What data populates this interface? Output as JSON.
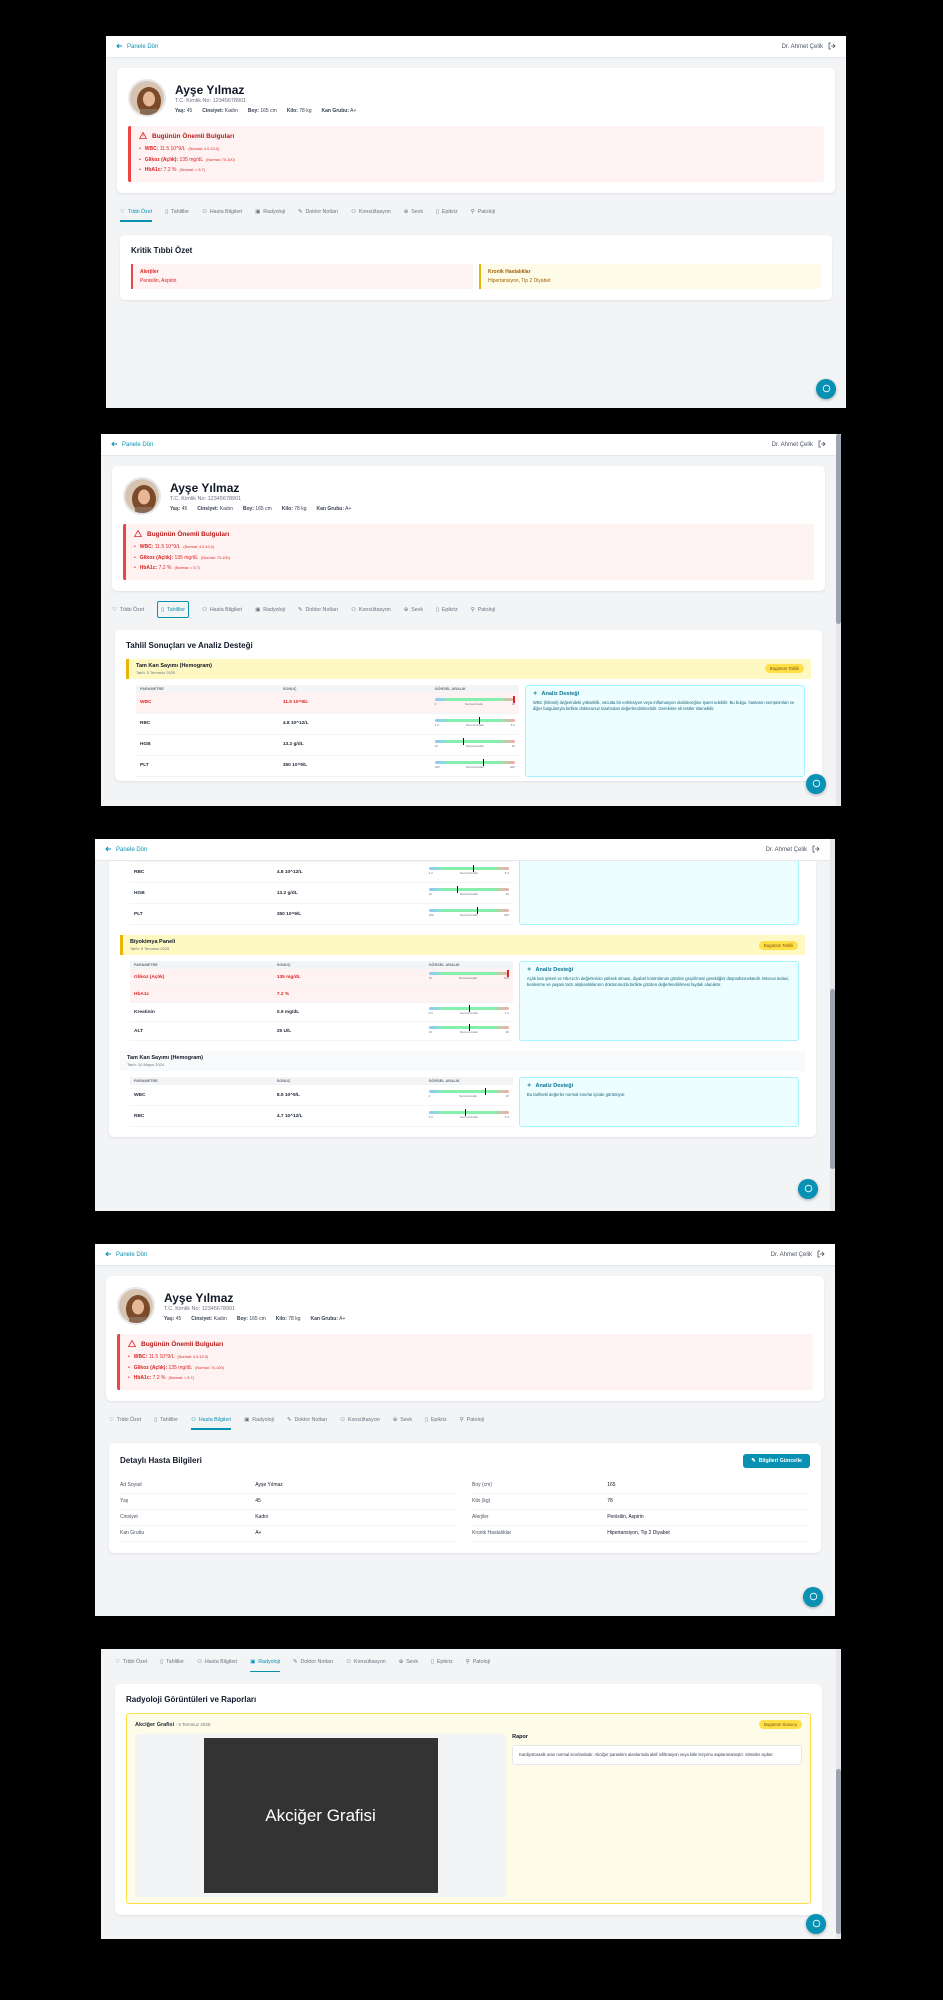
{
  "nav": {
    "back_label": "Panele Dön",
    "doctor": "Dr. Ahmet Çelik"
  },
  "patient": {
    "name": "Ayşe Yılmaz",
    "tc": "T.C. Kimlik No: 12345678901",
    "stats": [
      {
        "k": "Yaş:",
        "v": "45"
      },
      {
        "k": "Cinsiyet:",
        "v": "Kadın"
      },
      {
        "k": "Boy:",
        "v": "165 cm"
      },
      {
        "k": "Kilo:",
        "v": "78 kg"
      },
      {
        "k": "Kan Grubu:",
        "v": "A+"
      }
    ]
  },
  "alert": {
    "title": "Bugünün Önemli Bulguları",
    "items": [
      {
        "label": "WBC:",
        "value": "11.5 10^9/L",
        "norm": "(Normal: 4.0-10.0)"
      },
      {
        "label": "Glikoz (Açlık):",
        "value": "135 mg/dL",
        "norm": "(Normal: 70-100)"
      },
      {
        "label": "HbA1c:",
        "value": "7.2 %",
        "norm": "(Normal: < 5.7)"
      }
    ]
  },
  "tabs": [
    "Tıbbi Özet",
    "Tahliller",
    "Hasta Bilgileri",
    "Radyoloji",
    "Doktor Notları",
    "Konsültasyon",
    "Sevk",
    "Epikriz",
    "Patoloji"
  ],
  "summary": {
    "title": "Kritik Tıbbi Özet",
    "allergies_title": "Alerjiler",
    "allergies": "Penisilin, Aspirin",
    "chronic_title": "Kronik Hastalıklar",
    "chronic": "Hipertansiyon, Tip 2 Diyabet"
  },
  "labs": {
    "title": "Tahlil Sonuçları ve Analiz Desteği",
    "col_param": "PARAMETRE",
    "col_result": "SONUÇ",
    "col_range": "GÖRSEL ARALIK",
    "range_label": "Normal Aralık",
    "analysis_title": "Analiz Desteği",
    "today_badge": "Bugünün Tahlili",
    "hemogram": {
      "name": "Tam Kan Sayımı (Hemogram)",
      "date": "Tarih: 5 Temmuz 2025",
      "rows": [
        {
          "p": "WBC",
          "r": "11.5 10^9/L",
          "min": "4",
          "max": "10",
          "level": 0.98,
          "high": true
        },
        {
          "p": "RBC",
          "r": "4.8 10^12/L",
          "min": "4.2",
          "max": "5.4",
          "level": 0.55,
          "high": false
        },
        {
          "p": "HGB",
          "r": "13.2 g/dL",
          "min": "12",
          "max": "16",
          "level": 0.35,
          "high": false
        },
        {
          "p": "PLT",
          "r": "350 10^9/L",
          "min": "150",
          "max": "400",
          "level": 0.6,
          "high": false
        }
      ],
      "analysis": "WBC (lökosit) değerindeki yükseklik, vücutta bir enfeksiyon veya inflamasyon olabileceğine işaret edebilir. Bu bulgu, hastanın semptomları ve diğer bulgularıyla birlikte doktorunuz tarafından değerlendirilmelidir. Gerekirse ek testler istenebilir."
    },
    "biochem": {
      "name": "Biyokimya Paneli",
      "date": "Tarih: 5 Temmuz 2025",
      "rows": [
        {
          "p": "Glikoz (Açlık)",
          "r": "135 mg/dL",
          "min": "70",
          "max": "100",
          "level": 0.98,
          "high": true,
          "bar": true
        },
        {
          "p": "HbA1c",
          "r": "7.2 %",
          "high": true,
          "bar": false
        },
        {
          "p": "Kreatinin",
          "r": "0.9 mg/dL",
          "min": "0.6",
          "max": "1.2",
          "level": 0.5,
          "high": false,
          "bar": true
        },
        {
          "p": "ALT",
          "r": "25 U/L",
          "min": "10",
          "max": "40",
          "level": 0.5,
          "high": false,
          "bar": true
        }
      ],
      "analysis": "Açlık kan şekeri ve HbA1c'in değerlerinin yüksek olması, diyabet kontrolünün gözden geçirilmesi gerektiğini düşündürmektedir. Mevcut tedavi, beslenme ve yaşam tarzı alışkanlıklarının doktorunuzla birlikte gözden değerlendirilmesi faydalı olacaktır."
    },
    "old": {
      "name": "Tam Kan Sayımı (Hemogram)",
      "date": "Tarih: 10 Mayıs 2024",
      "rows": [
        {
          "p": "WBC",
          "r": "8.5 10^9/L",
          "min": "4",
          "max": "10",
          "level": 0.7,
          "high": false
        },
        {
          "p": "RBC",
          "r": "4.7 10^12/L",
          "min": "4.2",
          "max": "5.4",
          "level": 0.45,
          "high": false
        }
      ],
      "analysis": "Bu tarihteki değerler normal sınırlar içinde görünüyor."
    }
  },
  "details": {
    "title": "Detaylı Hasta Bilgileri",
    "update_button": "Bilgileri Güncelle",
    "left": [
      {
        "k": "Ad Soyad",
        "v": "Ayşe Yılmaz"
      },
      {
        "k": "Yaş",
        "v": "45"
      },
      {
        "k": "Cinsiyet",
        "v": "Kadın"
      },
      {
        "k": "Kan Grubu",
        "v": "A+"
      }
    ],
    "right": [
      {
        "k": "Boy (cm)",
        "v": "165"
      },
      {
        "k": "Kilo (kg)",
        "v": "78"
      },
      {
        "k": "Alerjiler",
        "v": "Penisilin, Aspirin"
      },
      {
        "k": "Kronik Hastalıklar",
        "v": "Hipertansiyon, Tip 2 Diyabet"
      }
    ]
  },
  "radiology": {
    "title": "Radyoloji Görüntüleri ve Raporları",
    "item_name": "Akciğer Grafisi",
    "item_date": "- 5 Temmuz 2025",
    "badge": "Bugünün Sonucu",
    "image_label": "Akciğer Grafisi",
    "report_title": "Rapor",
    "report_text": "Kardiyotorasik oran normal sınırlardadır. Akciğer parankim alanlarında aktif infiltrasyon veya kitle lezyonu saptanmamıştır. Sinüsler açıktır."
  },
  "colors": {
    "accent": "#0891b2",
    "alert": "#dc2626",
    "highlight": "#fef9c3"
  }
}
